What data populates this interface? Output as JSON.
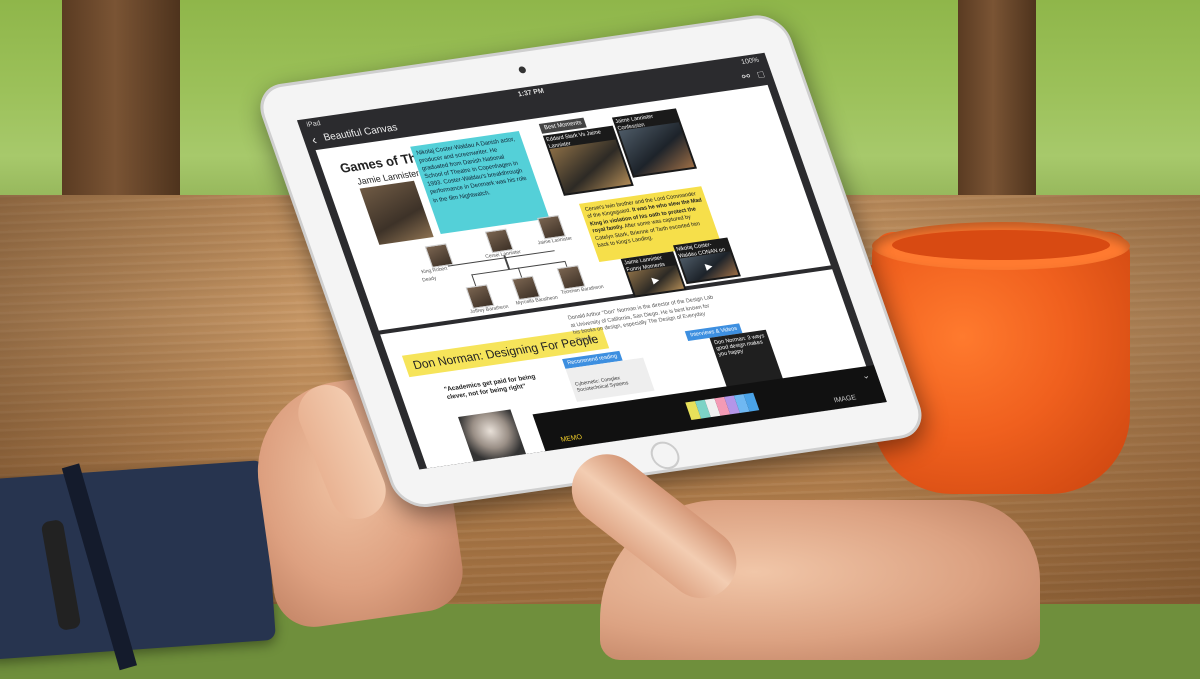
{
  "status_bar": {
    "device": "iPad",
    "time": "1:37 PM",
    "battery": "100%"
  },
  "nav": {
    "back_icon": "chevron-left-icon",
    "title": "Beautiful Canvas",
    "share_icon": "share-icon",
    "menu_icon": "document-icon"
  },
  "got_card": {
    "title": "Games of Thrones 1 - 3",
    "subtitle": "Jamie Lannister",
    "bio": "Nikolaj Coster-Waldau A Danish actor, producer and screenwriter. He graduated from Danish National School of Theatre in Copenhagen in 1993. Coster-Waldau's breakthrough performance in Denmark was his role in the film Nightwatch.",
    "family_tree": {
      "top": [
        "King Robert",
        "Cersei Lannister",
        "Jaime Lannister"
      ],
      "bottom": [
        "Joffrey Baratheon",
        "Myrcella Baratheon",
        "Tommen Baratheon"
      ],
      "side": "Deady"
    },
    "moments_tag": "Best Moments",
    "thumbs": [
      {
        "title": "Eddard Stark Vs Jaime Lannister"
      },
      {
        "title": "Jaime Lannister Confession"
      },
      {
        "title": "Jaime Lannister Funny Moments"
      },
      {
        "title": "Nikolaj Coster-Waldau CONAN on TBS"
      }
    ],
    "story": {
      "plain_1": "Cersei's twin brother and the Lord Commander of the Kingsguard. ",
      "bold": "It was he who slew the Mad King in violation of his oath to protect the royal family.",
      "plain_2": " After some was captured by Catelyn Stark, Brienne of Tarth escorted him back to King's Landing."
    }
  },
  "dn_card": {
    "title": "Don Norman: Designing For People",
    "bio": "Donald Arthur \"Don\" Norman is the director of the Design Lab at University of California, San Diego. He is best known for his books on design, especially The Design of Everyday Things.",
    "quote": "\"Academics get paid for being clever, not for being right\"",
    "reading_tag": "Recommend reading",
    "reading_item": "Cybernetic: Complex Sociotechnical Systems",
    "video_tag": "Interviews & Videos",
    "video_title": "Don Norman: 3 ways good design makes you happy"
  },
  "toolbar": {
    "memo_label": "MEMO",
    "image_label": "IMAGE",
    "collapse_icon": "chevron-down-icon",
    "swatch_colors": [
      "#e8e15a",
      "#7dd3c6",
      "#f0f0f0",
      "#f49ab5",
      "#b495e8",
      "#6fb8f2",
      "#4aa3e8"
    ]
  },
  "colors": {
    "highlight_cyan": "#54d0d8",
    "highlight_yellow": "#f6df4a",
    "accent_blue": "#3d8fe0",
    "active_tab": "#f3cf2a"
  }
}
